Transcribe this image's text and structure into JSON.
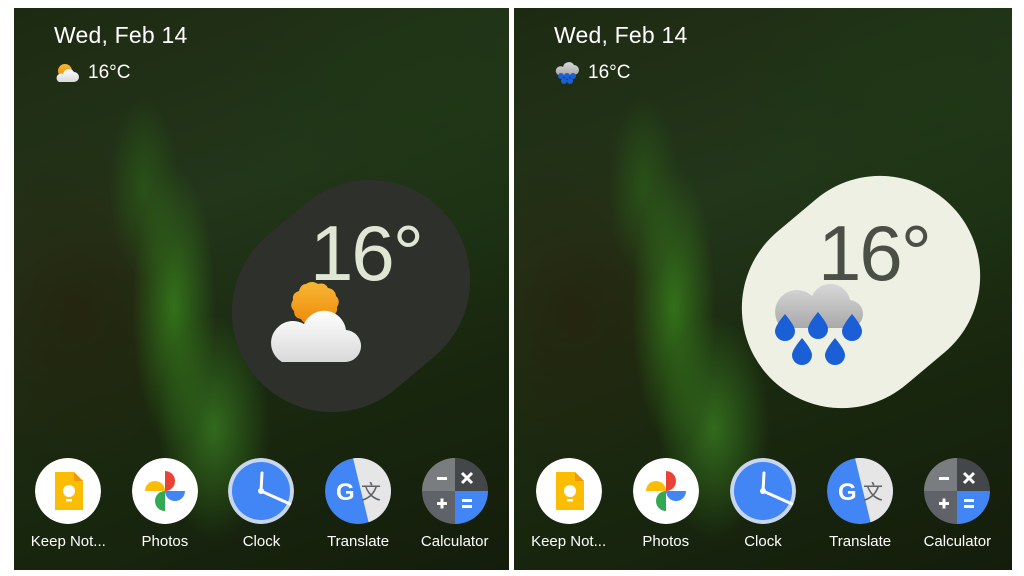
{
  "panels": [
    {
      "id": "left",
      "date": "Wed, Feb 14",
      "small_temp": "16°C",
      "condition": "partly-cloudy",
      "big_temp": "16°",
      "widget_theme": "dark",
      "colors": {
        "widget_bg": "#2e302b",
        "temp_text": "#dfe7d4"
      }
    },
    {
      "id": "right",
      "date": "Wed, Feb 14",
      "small_temp": "16°C",
      "condition": "rain",
      "big_temp": "16°",
      "widget_theme": "light",
      "colors": {
        "widget_bg": "#eef0e4",
        "temp_text": "#4b4f45"
      }
    }
  ],
  "dock": {
    "apps": [
      {
        "label": "Keep Not...",
        "icon": "keep-notes-icon"
      },
      {
        "label": "Photos",
        "icon": "photos-icon"
      },
      {
        "label": "Clock",
        "icon": "clock-icon"
      },
      {
        "label": "Translate",
        "icon": "translate-icon"
      },
      {
        "label": "Calculator",
        "icon": "calculator-icon"
      }
    ]
  },
  "colors": {
    "sun": "#f5a31a",
    "cloud": "#f2f2f2",
    "rain": "#1a5fd6",
    "google_blue": "#4285f4",
    "google_red": "#ea4335",
    "google_yellow": "#fbbc04",
    "google_green": "#34a853"
  }
}
